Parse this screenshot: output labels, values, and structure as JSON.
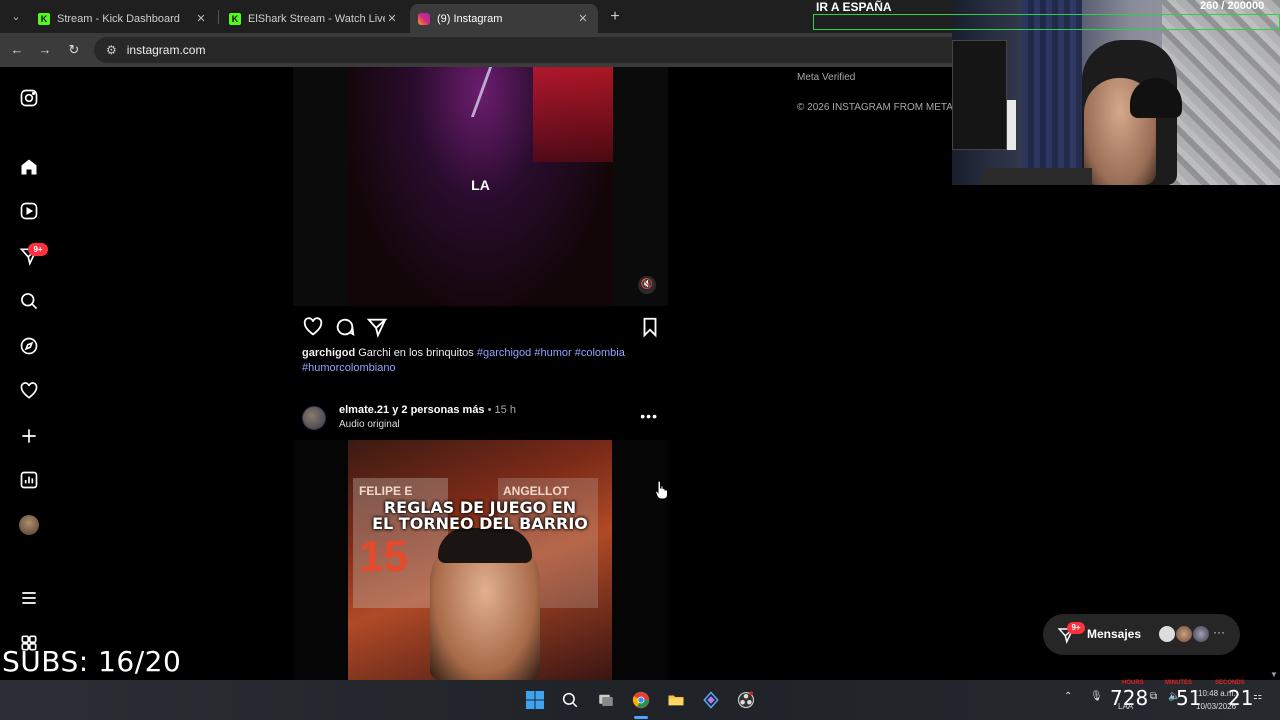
{
  "browser": {
    "tabs": [
      {
        "title": "Stream - Kick Dashboard",
        "active": false,
        "favicon": "kick-icon"
      },
      {
        "title": "ElShark Stream - Watch Live on Kick",
        "active": false,
        "favicon": "kick-icon"
      },
      {
        "title": "(9) Instagram",
        "active": true,
        "favicon": "instagram-icon"
      }
    ],
    "url": "instagram.com"
  },
  "sidebar": {
    "items": [
      "instagram-logo",
      "home",
      "reels",
      "messages",
      "search",
      "explore",
      "notifications",
      "create",
      "dashboard",
      "profile",
      "more",
      "also-from-meta"
    ],
    "messages_badge": "9+"
  },
  "post1": {
    "video_text": "LA",
    "caption_user": "garchigod",
    "caption_text": "Garchi en los brinquitos",
    "hashtags": [
      "#garchigod",
      "#humor",
      "#colombia",
      "#humorcolombiano"
    ]
  },
  "post2": {
    "user": "elmate.21",
    "with_text": "y 2 personas más",
    "dot": "•",
    "time": "15 h",
    "audio": "Audio original",
    "video_title_line1": "REGLAS DE JUEGO EN",
    "video_title_line2": "EL TORNEO DEL BARRIO",
    "jersey_text": "FELIPE E",
    "jersey_text2": "ANGELLOT",
    "jersey_number": "15"
  },
  "footer": {
    "meta_verified": "Meta Verified",
    "copyright": "© 2026 INSTAGRAM FROM META"
  },
  "overlay": {
    "goal_label": "IR A ESPAÑA",
    "goal_count": "260 / 200000",
    "subs": "SUBS: 16/20"
  },
  "messages_widget": {
    "label": "Mensajes",
    "badge": "9+"
  },
  "taskbar": {
    "big_numbers": [
      "728",
      "51",
      "21"
    ],
    "clock_time": "10:48 a.m.",
    "clock_date": "10/03/2026",
    "lang": "LAA",
    "counter_labels": [
      "HOURS",
      "MINUTES",
      "SECONDS"
    ]
  },
  "colors": {
    "instagram_bg": "#000000",
    "hashtag": "#8ea4ff",
    "badge_red": "#ff3040",
    "kick_green": "#53fc18",
    "goal_green": "#2bd14b"
  }
}
